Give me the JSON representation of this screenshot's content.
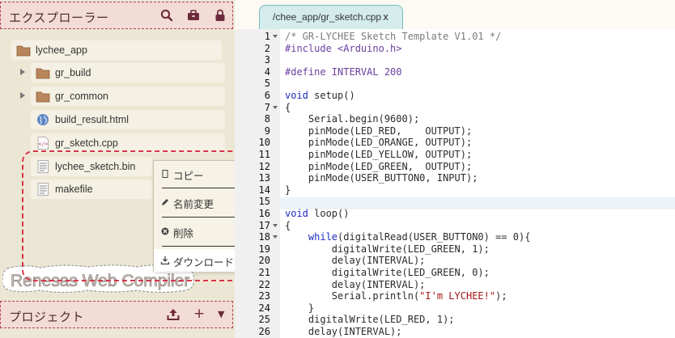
{
  "explorer": {
    "title": "エクスプローラー",
    "icons": [
      "search-icon",
      "toolbox-icon",
      "lock-icon"
    ],
    "items": [
      {
        "label": "lychee_app",
        "icon": "folder-icon",
        "type": "folder"
      },
      {
        "label": "gr_build",
        "icon": "folder-icon",
        "type": "folder"
      },
      {
        "label": "gr_common",
        "icon": "folder-icon",
        "type": "folder"
      },
      {
        "label": "build_result.html",
        "icon": "globe-icon",
        "type": "file"
      },
      {
        "label": "gr_sketch.cpp",
        "icon": "code-file-icon",
        "type": "file"
      },
      {
        "label": "lychee_sketch.bin",
        "icon": "text-file-icon",
        "type": "file"
      },
      {
        "label": "makefile",
        "icon": "text-file-icon",
        "type": "file"
      }
    ]
  },
  "context_menu": {
    "items": [
      {
        "label": "コピー",
        "icon": "copy-icon"
      },
      {
        "label": "名前変更",
        "icon": "pencil-icon"
      },
      {
        "label": "削除",
        "icon": "delete-icon"
      },
      {
        "label": "ダウンロード",
        "icon": "download-icon"
      }
    ]
  },
  "brand": {
    "text": "Renesas Web Compiler"
  },
  "project": {
    "title": "プロジェクト",
    "icons": [
      "upload-icon",
      "plus-icon",
      "dropdown-icon"
    ],
    "plus_label": "+",
    "dropdown_label": "▼"
  },
  "editor": {
    "tab_label": "/chee_app/gr_sketch.cpp",
    "tab_close": "x",
    "lines": [
      {
        "n": "1",
        "fold": true,
        "parts": [
          {
            "t": "/* GR-LYCHEE Sketch Template V1.01 */",
            "c": "c-comment"
          }
        ]
      },
      {
        "n": "2",
        "fold": false,
        "parts": [
          {
            "t": "#include <Arduino.h>",
            "c": "c-pre"
          }
        ]
      },
      {
        "n": "3",
        "fold": false,
        "parts": []
      },
      {
        "n": "4",
        "fold": false,
        "parts": [
          {
            "t": "#define INTERVAL 200",
            "c": "c-pre"
          }
        ]
      },
      {
        "n": "5",
        "fold": false,
        "parts": []
      },
      {
        "n": "6",
        "fold": false,
        "parts": [
          {
            "t": "void",
            "c": "c-kw"
          },
          {
            "t": " setup()",
            "c": "c-id"
          }
        ]
      },
      {
        "n": "7",
        "fold": true,
        "parts": [
          {
            "t": "{",
            "c": "c-id"
          }
        ]
      },
      {
        "n": "8",
        "fold": false,
        "parts": [
          {
            "t": "    Serial.begin(9600);",
            "c": "c-id"
          }
        ]
      },
      {
        "n": "9",
        "fold": false,
        "parts": [
          {
            "t": "    pinMode(LED_RED,    OUTPUT);",
            "c": "c-id"
          }
        ]
      },
      {
        "n": "10",
        "fold": false,
        "parts": [
          {
            "t": "    pinMode(LED_ORANGE, OUTPUT);",
            "c": "c-id"
          }
        ]
      },
      {
        "n": "11",
        "fold": false,
        "parts": [
          {
            "t": "    pinMode(LED_YELLOW, OUTPUT);",
            "c": "c-id"
          }
        ]
      },
      {
        "n": "12",
        "fold": false,
        "parts": [
          {
            "t": "    pinMode(LED_GREEN,  OUTPUT);",
            "c": "c-id"
          }
        ]
      },
      {
        "n": "13",
        "fold": false,
        "parts": [
          {
            "t": "    pinMode(USER_BUTTON0, INPUT);",
            "c": "c-id"
          }
        ]
      },
      {
        "n": "14",
        "fold": false,
        "parts": [
          {
            "t": "}",
            "c": "c-id"
          }
        ]
      },
      {
        "n": "15",
        "fold": false,
        "parts": []
      },
      {
        "n": "16",
        "fold": false,
        "parts": [
          {
            "t": "void",
            "c": "c-kw"
          },
          {
            "t": " loop()",
            "c": "c-id"
          }
        ]
      },
      {
        "n": "17",
        "fold": true,
        "parts": [
          {
            "t": "{",
            "c": "c-id"
          }
        ]
      },
      {
        "n": "18",
        "fold": true,
        "parts": [
          {
            "t": "    ",
            "c": "c-id"
          },
          {
            "t": "while",
            "c": "c-kw"
          },
          {
            "t": "(digitalRead(USER_BUTTON0) == 0){",
            "c": "c-id"
          }
        ]
      },
      {
        "n": "19",
        "fold": false,
        "parts": [
          {
            "t": "        digitalWrite(LED_GREEN, 1);",
            "c": "c-id"
          }
        ]
      },
      {
        "n": "20",
        "fold": false,
        "parts": [
          {
            "t": "        delay(INTERVAL);",
            "c": "c-id"
          }
        ]
      },
      {
        "n": "21",
        "fold": false,
        "parts": [
          {
            "t": "        digitalWrite(LED_GREEN, 0);",
            "c": "c-id"
          }
        ]
      },
      {
        "n": "22",
        "fold": false,
        "parts": [
          {
            "t": "        delay(INTERVAL);",
            "c": "c-id"
          }
        ]
      },
      {
        "n": "23",
        "fold": false,
        "parts": [
          {
            "t": "        Serial.println(",
            "c": "c-id"
          },
          {
            "t": "\"I'm LYCHEE!\"",
            "c": "c-str"
          },
          {
            "t": ");",
            "c": "c-id"
          }
        ]
      },
      {
        "n": "24",
        "fold": false,
        "parts": [
          {
            "t": "    }",
            "c": "c-id"
          }
        ]
      },
      {
        "n": "25",
        "fold": false,
        "parts": [
          {
            "t": "    digitalWrite(LED_RED, 1);",
            "c": "c-id"
          }
        ]
      },
      {
        "n": "26",
        "fold": false,
        "parts": [
          {
            "t": "    delay(INTERVAL);",
            "c": "c-id"
          }
        ]
      }
    ]
  }
}
